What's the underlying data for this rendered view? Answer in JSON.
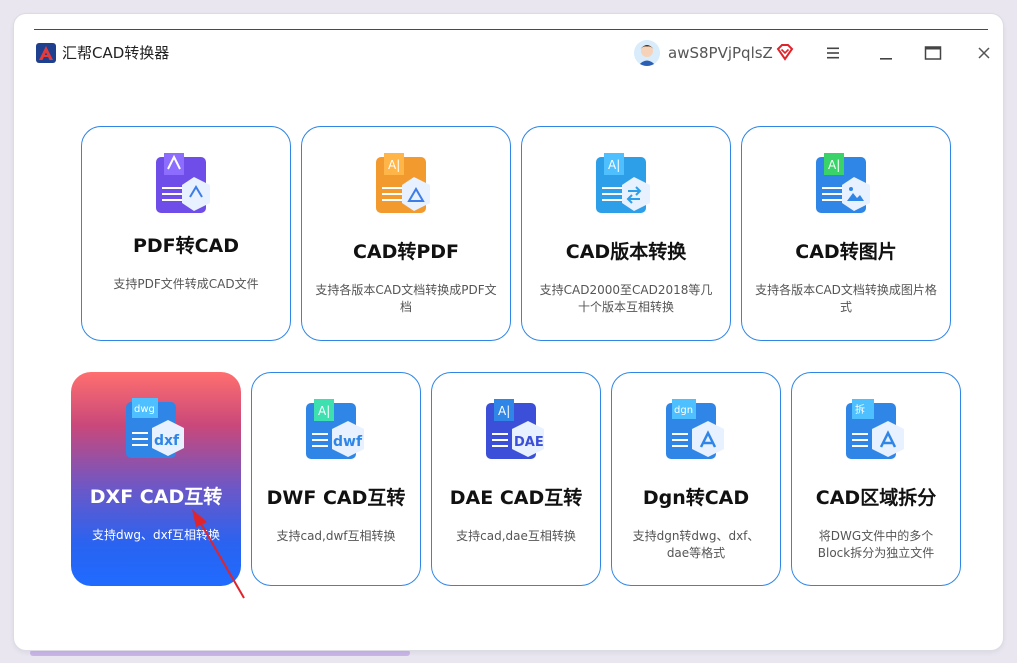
{
  "app": {
    "title": "汇帮CAD转换器",
    "username": "awS8PVjPqlsZ",
    "accent_color": "#2f86e6"
  },
  "window_controls": {
    "menu_icon": "hamburger-menu-icon",
    "minimize_icon": "minimize-icon",
    "maximize_icon": "maximize-icon",
    "close_icon": "close-icon"
  },
  "tools_row1": [
    {
      "title": "PDF转CAD",
      "desc": "支持PDF文件转成CAD文件",
      "icon": "pdf-to-cad-icon"
    },
    {
      "title": "CAD转PDF",
      "desc": "支持各版本CAD文档转换成PDF文档",
      "icon": "cad-to-pdf-icon"
    },
    {
      "title": "CAD版本转换",
      "desc": "支持CAD2000至CAD2018等几十个版本互相转换",
      "icon": "cad-version-convert-icon"
    },
    {
      "title": "CAD转图片",
      "desc": "支持各版本CAD文档转换成图片格式",
      "icon": "cad-to-image-icon"
    }
  ],
  "tools_row2": [
    {
      "title": "DXF CAD互转",
      "desc": "支持dwg、dxf互相转换",
      "icon": "dxf-convert-icon",
      "icon_text": "dwg",
      "icon_big": "dxf",
      "active": true
    },
    {
      "title": "DWF CAD互转",
      "desc": "支持cad,dwf互相转换",
      "icon": "dwf-convert-icon",
      "icon_big": "dwf"
    },
    {
      "title": "DAE CAD互转",
      "desc": "支持cad,dae互相转换",
      "icon": "dae-convert-icon",
      "icon_big": "DAE"
    },
    {
      "title": "Dgn转CAD",
      "desc": "支持dgn转dwg、dxf、dae等格式",
      "icon": "dgn-to-cad-icon",
      "icon_text": "dgn"
    },
    {
      "title": "CAD区域拆分",
      "desc": "将DWG文件中的多个Block拆分为独立文件",
      "icon": "cad-split-icon",
      "icon_text": "拆"
    }
  ]
}
